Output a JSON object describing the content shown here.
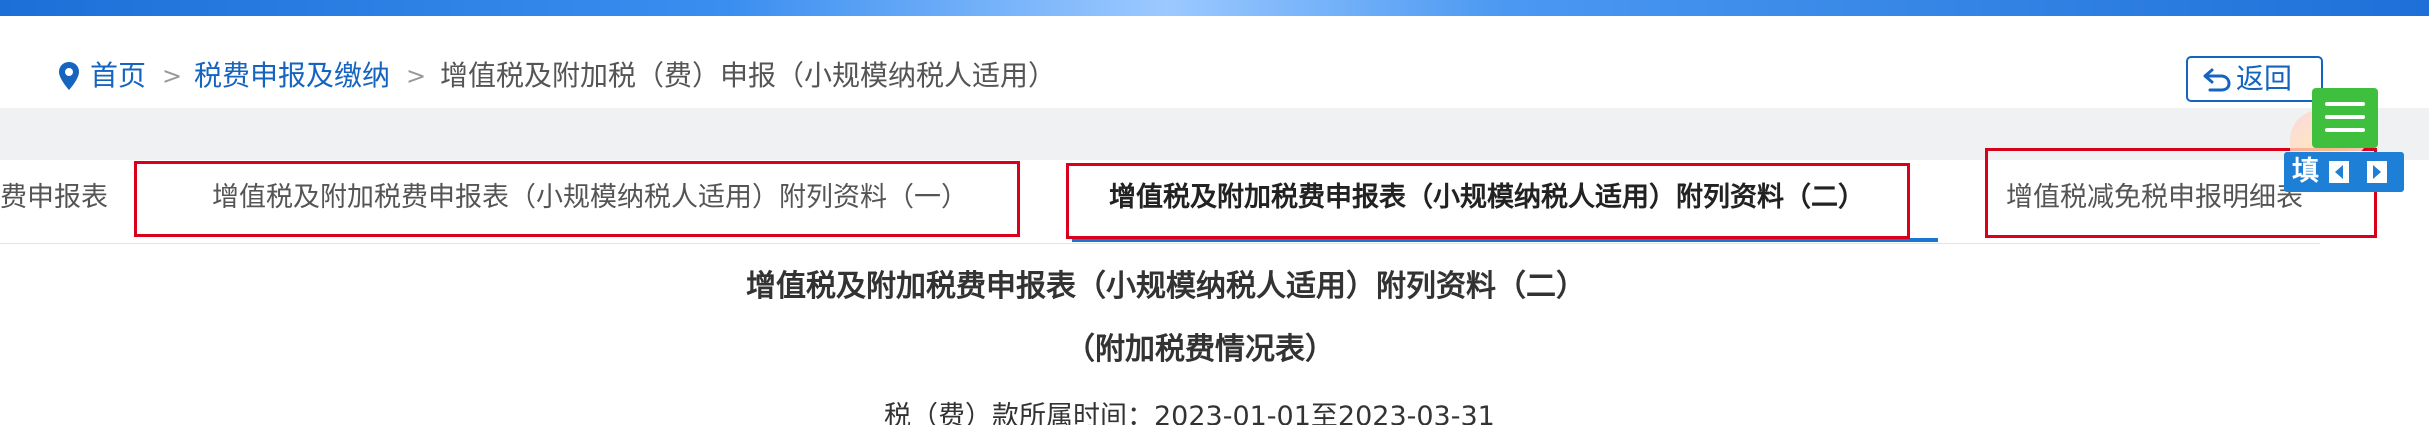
{
  "breadcrumb": {
    "home": "首页",
    "separator": ">",
    "level1": "税费申报及缴纳",
    "current": "增值税及附加税（费）申报（小规模纳税人适用）"
  },
  "header": {
    "back_label": "返回"
  },
  "tabs": [
    {
      "label": "费申报表",
      "active": false
    },
    {
      "label": "增值税及附加税费申报表（小规模纳税人适用）附列资料（一）",
      "active": false
    },
    {
      "label": "增值税及附加税费申报表（小规模纳税人适用）附列资料（二）",
      "active": true
    },
    {
      "label": "增值税减免税申报明细表",
      "active": false
    }
  ],
  "floating": {
    "fill_label": "填",
    "menu_icon": "hamburger-icon",
    "prev_icon": "chevron-left-icon",
    "next_icon": "chevron-right-icon"
  },
  "form": {
    "title": "增值税及附加税费申报表（小规模纳税人适用）附列资料（二）",
    "subtitle": "（附加税费情况表）",
    "period_label": "税（费）款所属时间：",
    "period_value": "2023-01-01至2023-03-31"
  },
  "colors": {
    "link": "#1565c0",
    "highlight_box": "#d9001b",
    "active_underline": "#1976d2",
    "float_menu": "#3ec03e"
  }
}
